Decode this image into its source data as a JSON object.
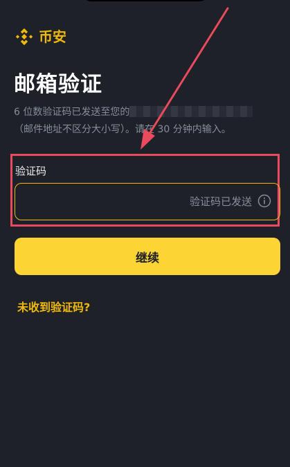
{
  "brand": {
    "name": "币安",
    "accent_color": "#f0b90b"
  },
  "page": {
    "title": "邮箱验证",
    "description_line1": "6 位数验证码已发送至您的",
    "description_line2_suffix": "。请在 30 分钟内输入。",
    "description_line2_prefix": "（邮件地址不区分大小写）"
  },
  "form": {
    "code_label": "验证码",
    "code_value": "",
    "sent_status": "验证码已发送",
    "info_icon": "info-circle-icon"
  },
  "actions": {
    "continue_label": "继续",
    "resend_link": "未收到验证码?"
  },
  "annotation": {
    "highlight_color": "#e94a5d"
  }
}
